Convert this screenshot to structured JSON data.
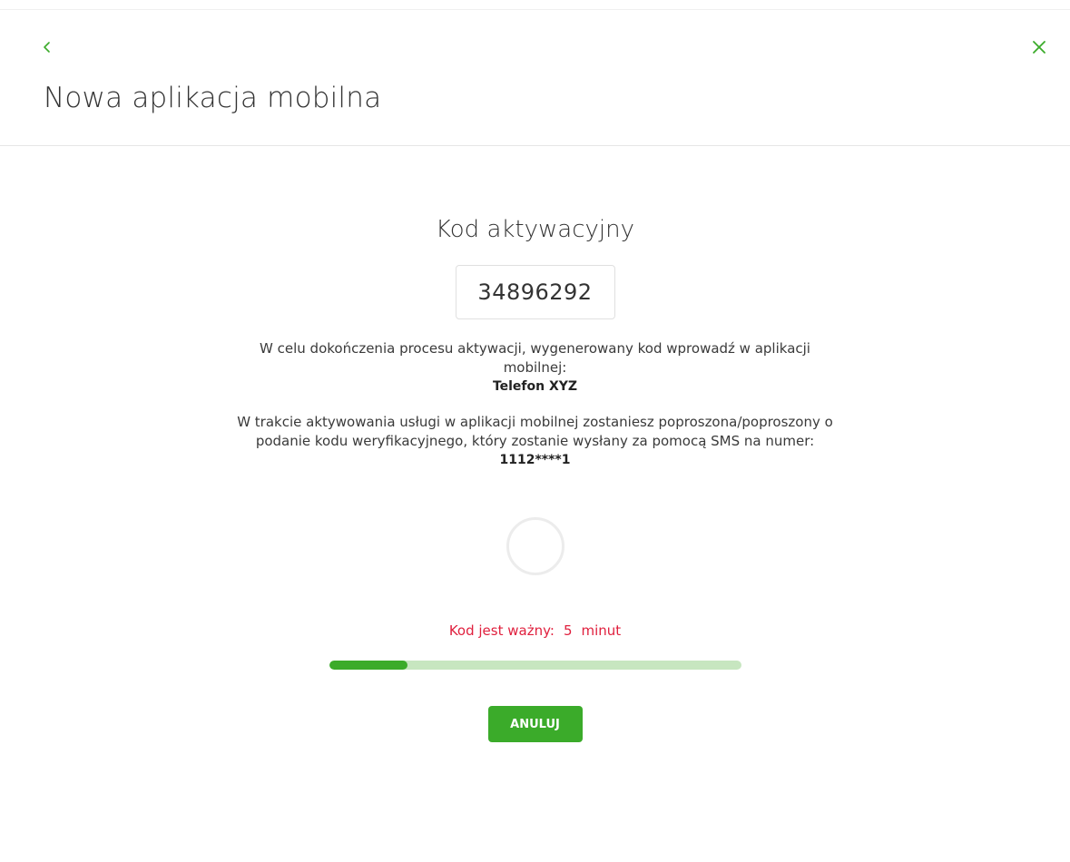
{
  "colors": {
    "accent": "#3bab2a",
    "progress_track": "#c7e6c0",
    "warning_text": "#e0203e"
  },
  "header": {
    "back_icon": "chevron-left-icon",
    "close_icon": "close-icon",
    "title": "Nowa aplikacja mobilna"
  },
  "activation": {
    "heading": "Kod aktywacyjny",
    "code": "34896292",
    "instruction": "W celu dokończenia procesu aktywacji, wygenerowany kod wprowadź w aplikacji mobilnej:",
    "device_name": "Telefon XYZ",
    "sms_info": "W trakcie aktywowania usługi w aplikacji mobilnej zostaniesz poproszona/poproszony o podanie kodu weryfikacyjnego, który zostanie wysłany za pomocą SMS na numer:",
    "phone_number": "1112****1"
  },
  "validity": {
    "label": "Kod jest ważny:",
    "value": "5",
    "unit": "minut",
    "progress_fraction": 0.19
  },
  "actions": {
    "cancel_label": "ANULUJ"
  }
}
